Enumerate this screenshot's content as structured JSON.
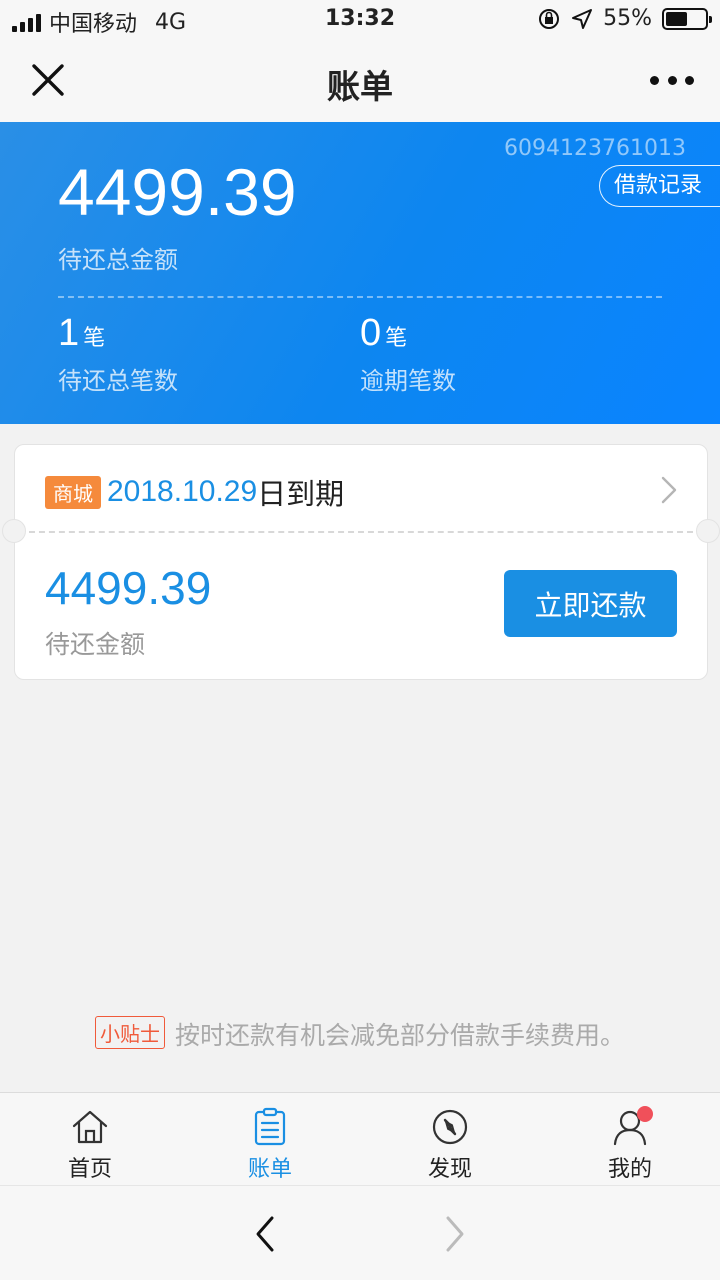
{
  "status_bar": {
    "carrier": "中国移动",
    "network": "4G",
    "time": "13:32",
    "battery_percent": "55%",
    "battery_level": 0.55
  },
  "navbar": {
    "title": "账单",
    "close_icon": "close-icon",
    "more_icon": "more-icon"
  },
  "summary": {
    "account_number": "6094123761013",
    "loan_record_label": "借款记录",
    "total_amount": "4499.39",
    "total_amount_label": "待还总金额",
    "pending_count": "1",
    "pending_unit": "笔",
    "pending_label": "待还总笔数",
    "overdue_count": "0",
    "overdue_unit": "笔",
    "overdue_label": "逾期笔数"
  },
  "bill": {
    "tag": "商城",
    "due_date": "2018.10.29",
    "due_suffix": "日到期",
    "amount": "4499.39",
    "amount_label": "待还金额",
    "repay_button": "立即还款"
  },
  "tip": {
    "tag": "小贴士",
    "text": "按时还款有机会减免部分借款手续费用。"
  },
  "tabs": [
    {
      "label": "首页",
      "icon": "home-icon",
      "active": false
    },
    {
      "label": "账单",
      "icon": "bill-icon",
      "active": true
    },
    {
      "label": "发现",
      "icon": "compass-icon",
      "active": false
    },
    {
      "label": "我的",
      "icon": "user-icon",
      "active": false
    }
  ],
  "colors": {
    "accent": "#1a8fe3",
    "header_blue": "#0d86f0",
    "tag_orange": "#f58a3c",
    "tip_red": "#f05a3a",
    "badge_red": "#f0505a"
  }
}
